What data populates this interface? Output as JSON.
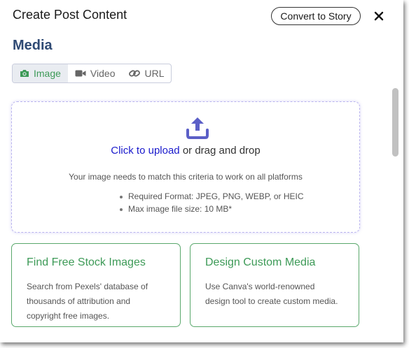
{
  "header": {
    "title": "Create Post Content",
    "convert_label": "Convert to Story"
  },
  "media": {
    "section_title": "Media",
    "tabs": [
      {
        "label": "Image",
        "icon": "camera-icon",
        "active": true
      },
      {
        "label": "Video",
        "icon": "video-icon",
        "active": false
      },
      {
        "label": "URL",
        "icon": "link-icon",
        "active": false
      }
    ]
  },
  "upload": {
    "icon": "upload-icon",
    "link_text": "Click to upload",
    "rest_text": " or drag and drop",
    "criteria": "Your image needs to match this criteria to work on all platforms",
    "requirements": [
      "Required Format: JPEG, PNG, WEBP, or HEIC",
      "Max image file size: 10 MB*"
    ]
  },
  "cards": [
    {
      "title": "Find Free Stock Images",
      "description": "Search from Pexels' database of thousands of attribution and copyright free images."
    },
    {
      "title": "Design Custom Media",
      "description": "Use Canva's world-renowned design tool to create custom media."
    }
  ],
  "colors": {
    "accent_green": "#3d9a57",
    "heading_blue": "#2f4a74",
    "link_blue": "#1a1acc",
    "upload_icon": "#5b5fc7"
  }
}
